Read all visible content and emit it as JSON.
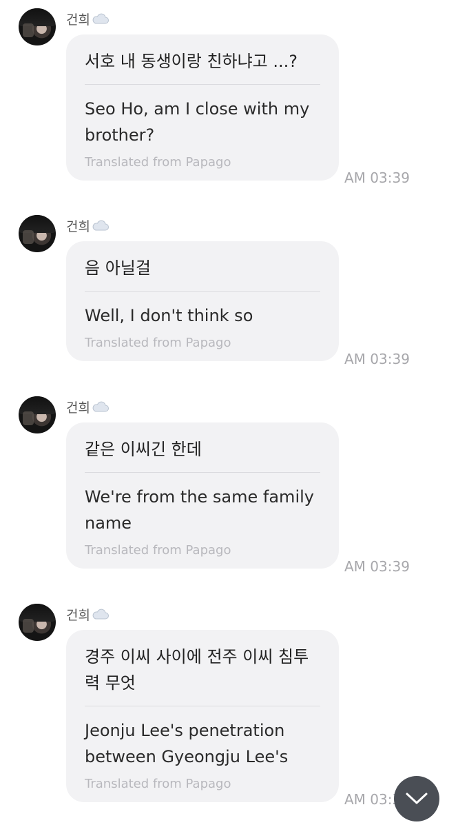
{
  "messages": [
    {
      "sender": "건희",
      "original": "서호 내 동생이랑 친하냐고 ...?",
      "translation": "Seo Ho, am I close with my brother?",
      "credit": "Translated from Papago",
      "time": "AM 03:39"
    },
    {
      "sender": "건희",
      "original": "음 아닐걸",
      "translation": "Well, I don't think so",
      "credit": "Translated from Papago",
      "time": "AM 03:39"
    },
    {
      "sender": "건희",
      "original": "같은 이씨긴 한데",
      "translation": "We're from the same family name",
      "credit": "Translated from Papago",
      "time": "AM 03:39"
    },
    {
      "sender": "건희",
      "original": "경주 이씨 사이에 전주 이씨 침투력 무엇",
      "translation": "Jeonju Lee's penetration between Gyeongju Lee's",
      "credit": "Translated from Papago",
      "time": "AM 03:39"
    }
  ],
  "icons": {
    "sender_badge": "cloud-icon",
    "scroll_button": "chevron-down-icon"
  }
}
